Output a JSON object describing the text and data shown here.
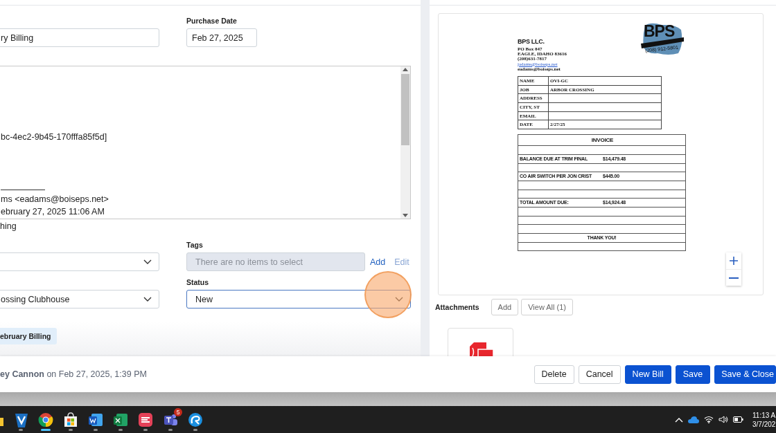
{
  "form": {
    "name_field": {
      "value": "ry Billing"
    },
    "purchase_date": {
      "label": "Purchase Date",
      "value": "Feb 27, 2025"
    },
    "message": {
      "lines": [
        {
          "kind": "blank"
        },
        {
          "kind": "blank"
        },
        {
          "kind": "blank"
        },
        {
          "kind": "blank"
        },
        {
          "kind": "blank"
        },
        {
          "kind": "text",
          "text": "bc-4ec2-9b45-170fffa85f5d]"
        },
        {
          "kind": "blank"
        },
        {
          "kind": "blank"
        },
        {
          "kind": "blank"
        },
        {
          "kind": "rule"
        },
        {
          "kind": "text",
          "text": "ms <eadams@boiseps.net>"
        },
        {
          "kind": "text",
          "text": "ebruary 27, 2025 11:06 AM"
        }
      ]
    },
    "note_text": "hing",
    "left_selects": [
      {
        "expanded": false
      },
      {
        "value": "ossing Clubhouse",
        "expanded": false
      }
    ],
    "tags": {
      "label": "Tags",
      "placeholder": "There are no items to select",
      "disabled": true,
      "links": [
        {
          "label": "Add",
          "disabled": false
        },
        {
          "label": "Edit",
          "disabled": true
        }
      ]
    },
    "status": {
      "label": "Status",
      "value": "New",
      "focused": true,
      "expanded": false
    },
    "chip": "ebruary Billing"
  },
  "viewer": {
    "document": {
      "company": "BPS LLC.",
      "address_lines": [
        "PO Box 847",
        "EAGLE, IDAHO 83616",
        "(208)631-7817"
      ],
      "link": "jadams@boiseps.net",
      "email": "eadams@boiseps.net",
      "logo": {
        "name": "BPS",
        "phone": "(208) 912-5801"
      },
      "info_rows": [
        {
          "label": "NAME",
          "value": "OVI-GC"
        },
        {
          "label": "JOB",
          "value": "ARBOR CROSSING"
        },
        {
          "label": "ADDRESS"
        },
        {
          "label": "CITY, ST"
        },
        {
          "label": "EMAIL"
        },
        {
          "label": "DATE",
          "value": "2/27/25"
        }
      ],
      "invoice": {
        "title": "INVOICE",
        "rows": [
          {
            "kind": "blank"
          },
          {
            "kind": "item",
            "description": "BALANCE DUE AT TRIM FINAL",
            "amount": "$14,479.48"
          },
          {
            "kind": "blank"
          },
          {
            "kind": "item",
            "description": "CO AIR SWITCH PER JON CRIST",
            "amount": "$445.00"
          },
          {
            "kind": "blank"
          },
          {
            "kind": "blank"
          },
          {
            "kind": "item",
            "description": "TOTAL AMOUNT DUE:",
            "amount": "$14,924.48"
          },
          {
            "kind": "blank"
          },
          {
            "kind": "blank"
          },
          {
            "kind": "blank"
          },
          {
            "kind": "note",
            "text": "THANK YOU!"
          },
          {
            "kind": "blank"
          }
        ]
      }
    },
    "attachments": {
      "label": "Attachments",
      "buttons": [
        "Add",
        "View All (1)"
      ],
      "files": [
        {
          "kind": "pdf"
        }
      ]
    }
  },
  "footer": {
    "audit_text": "**ey Cannon** on Feb 27, 2025, 1:39 PM",
    "buttons": [
      {
        "label": "Delete",
        "kind": "secondary"
      },
      {
        "label": "Cancel",
        "kind": "secondary"
      },
      {
        "label": "New Bill",
        "kind": "primary"
      },
      {
        "label": "Save",
        "kind": "primary"
      },
      {
        "label": "Save & Close",
        "kind": "primary"
      }
    ]
  },
  "taskbar": {
    "apps": [
      {
        "kind": "folder"
      },
      {
        "kind": "v-app",
        "active": false
      },
      {
        "kind": "browser",
        "active": true
      },
      {
        "kind": "store",
        "active": false
      },
      {
        "kind": "word",
        "active": false
      },
      {
        "kind": "excel",
        "active": false
      },
      {
        "kind": "notes",
        "active": false
      },
      {
        "kind": "teams",
        "active": false,
        "badge": "5"
      },
      {
        "kind": "remote",
        "active": false
      }
    ],
    "clock": {
      "time": "11:13 A",
      "date": "3/7/202"
    }
  }
}
